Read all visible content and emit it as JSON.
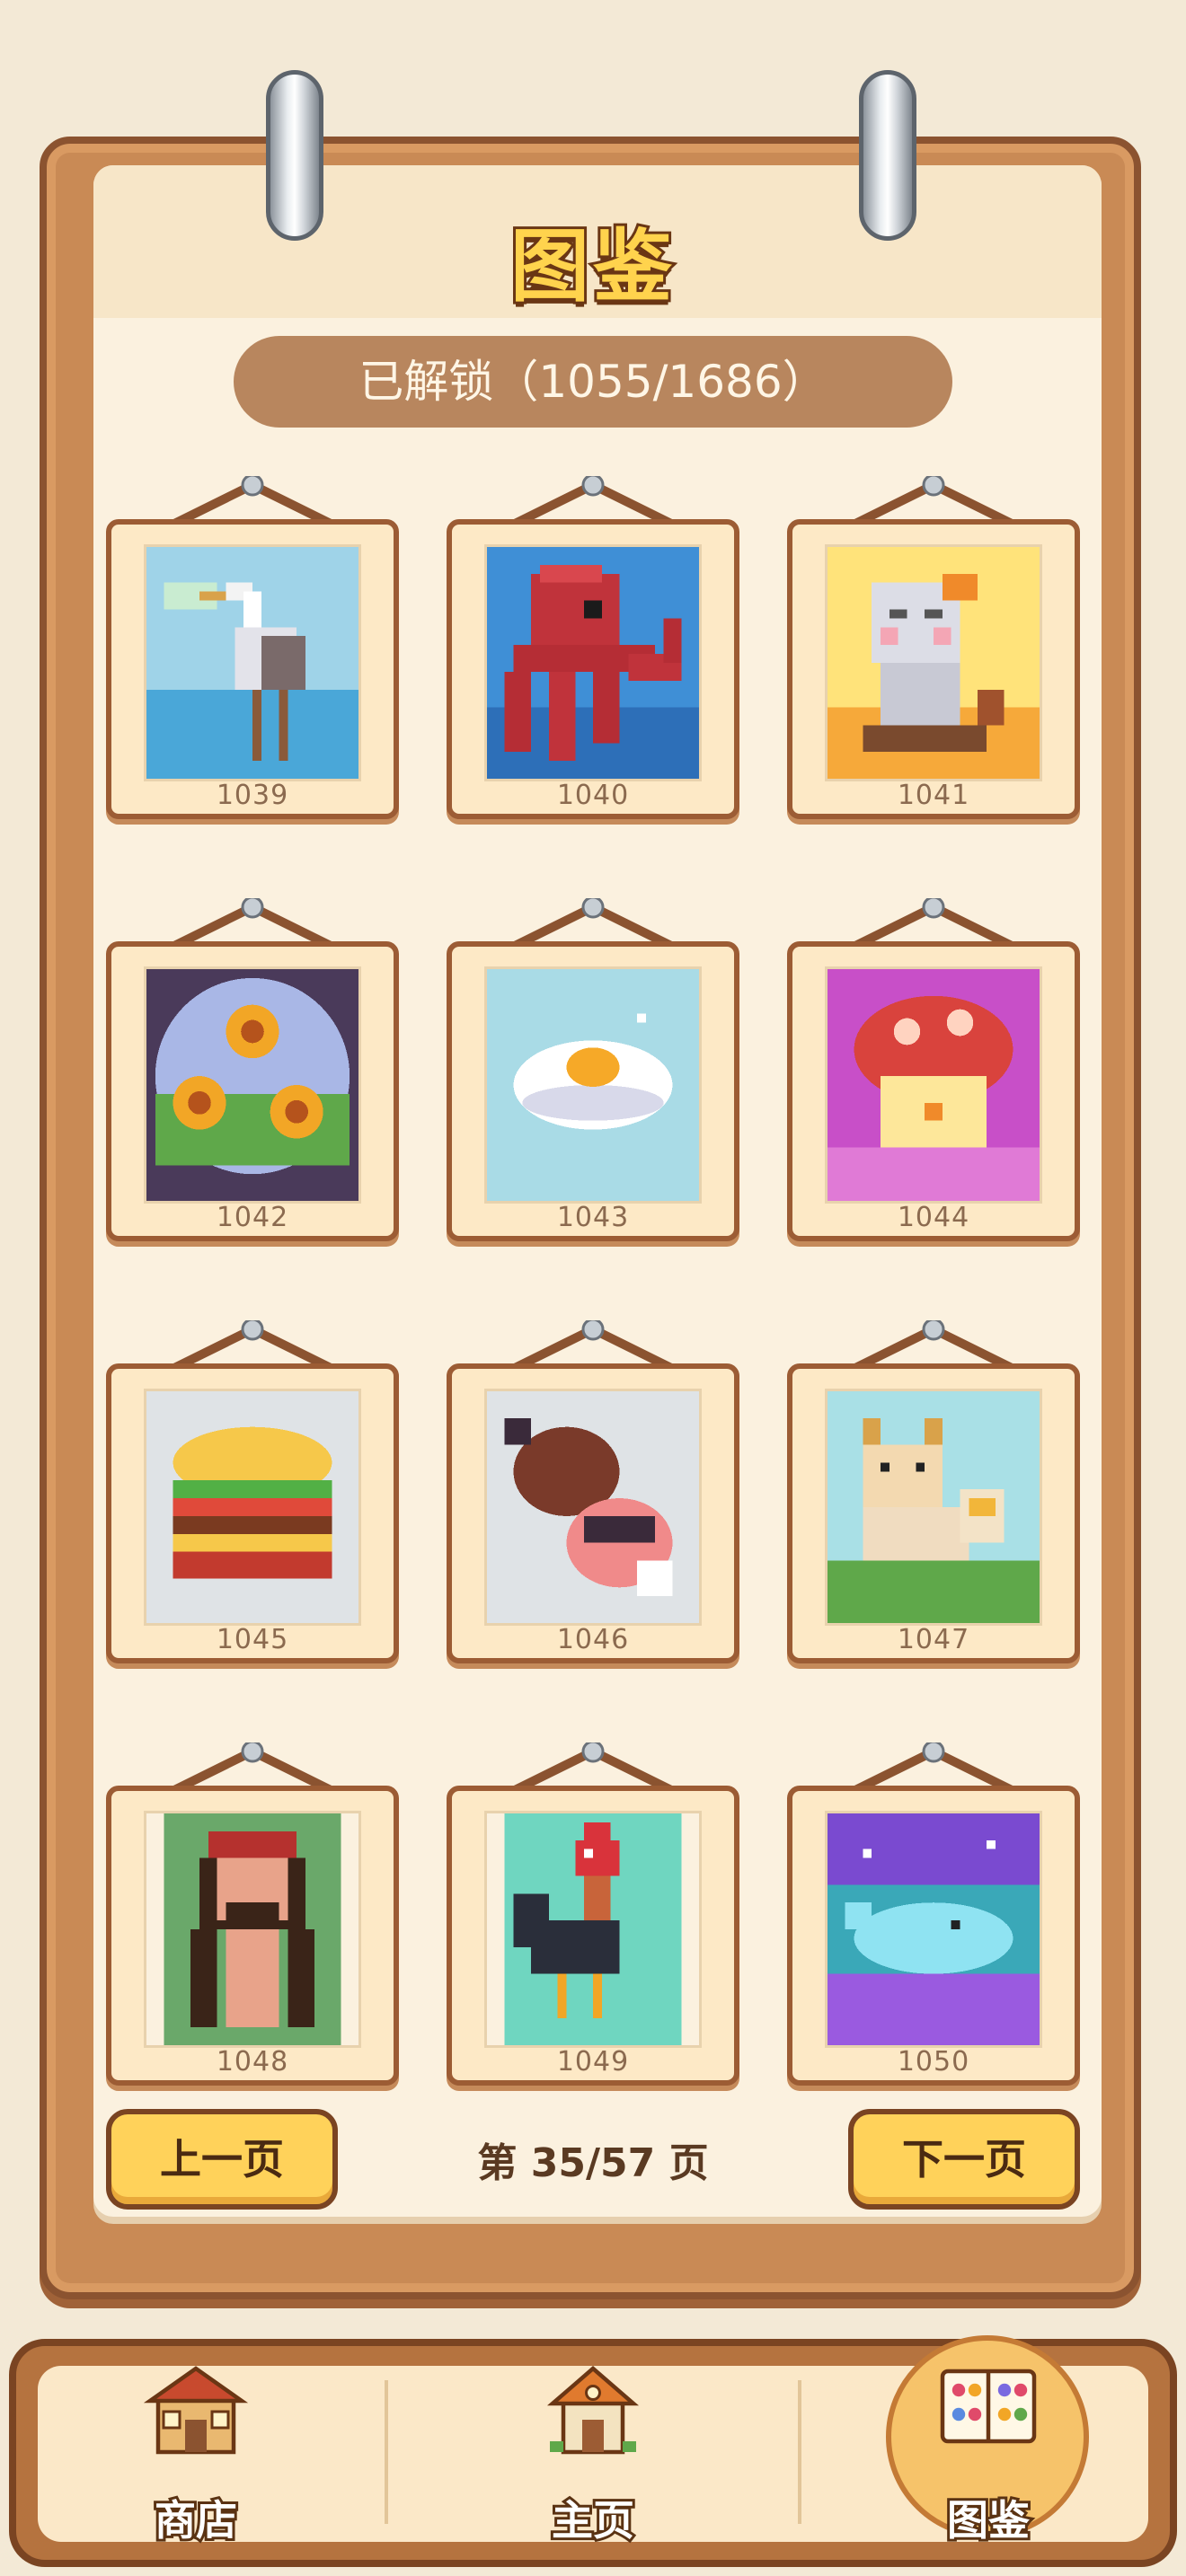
{
  "header": {
    "title": "图鉴",
    "unlocked": "已解锁（1055/1686）"
  },
  "gallery": {
    "items": [
      {
        "id": "1039",
        "subject": "heron"
      },
      {
        "id": "1040",
        "subject": "octopus"
      },
      {
        "id": "1041",
        "subject": "cartoon-character"
      },
      {
        "id": "1042",
        "subject": "sunflowers"
      },
      {
        "id": "1043",
        "subject": "fried-egg"
      },
      {
        "id": "1044",
        "subject": "mushroom"
      },
      {
        "id": "1045",
        "subject": "hamburger"
      },
      {
        "id": "1046",
        "subject": "meat-leg"
      },
      {
        "id": "1047",
        "subject": "corgi"
      },
      {
        "id": "1048",
        "subject": "pirate"
      },
      {
        "id": "1049",
        "subject": "rooster"
      },
      {
        "id": "1050",
        "subject": "whale"
      }
    ]
  },
  "pagination": {
    "prev_label": "上一页",
    "next_label": "下一页",
    "indicator": "第 35/57 页"
  },
  "bottom_nav": {
    "items": [
      {
        "label": "商店",
        "icon": "shop-icon"
      },
      {
        "label": "主页",
        "icon": "home-icon"
      },
      {
        "label": "图鉴",
        "icon": "collection-book-icon",
        "active": true
      }
    ]
  },
  "colors": {
    "background": "#f3e9d6",
    "board": "#c98a55",
    "paper": "#fbf1df",
    "button_yellow": "#ffd25a",
    "pill": "#b8865e"
  }
}
